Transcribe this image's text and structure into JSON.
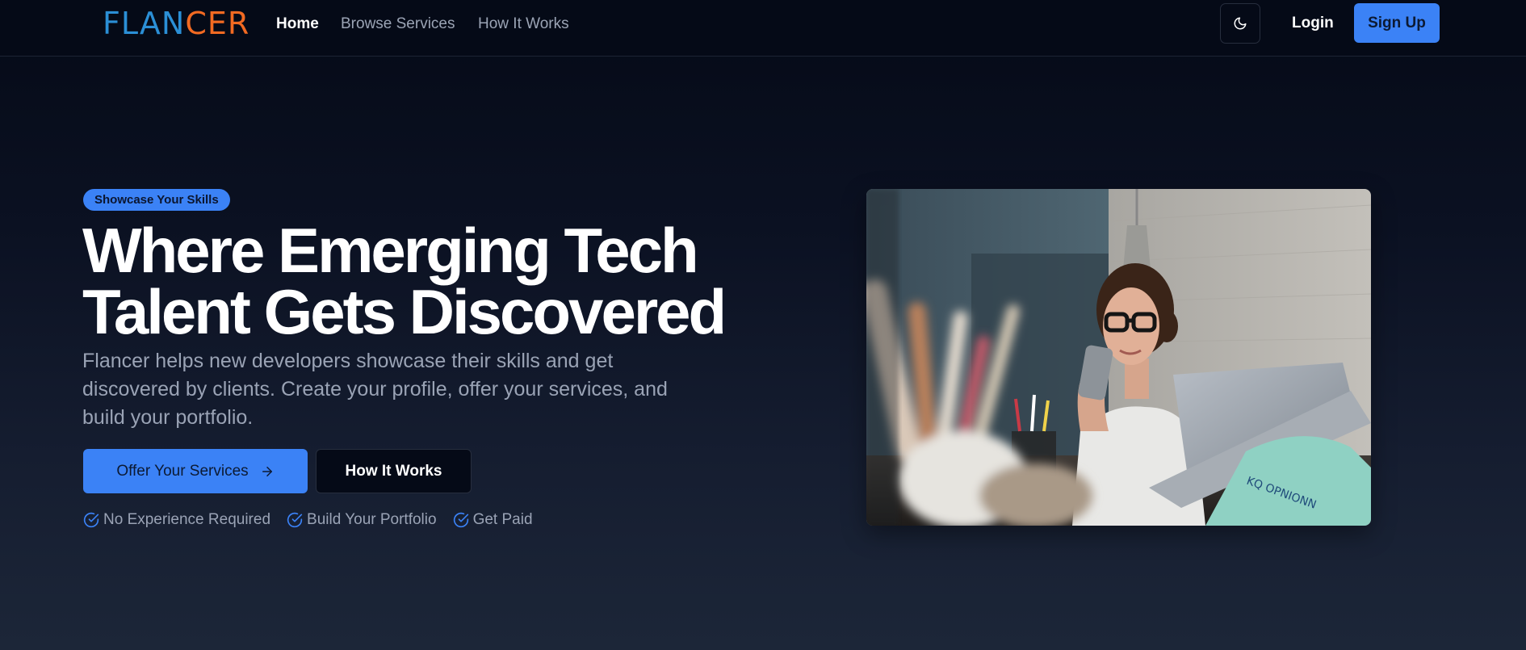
{
  "nav": {
    "logo_part1": "FLAN",
    "logo_part2": "CER",
    "links": [
      "Home",
      "Browse Services",
      "How It Works"
    ],
    "theme_icon": "moon-icon",
    "login_label": "Login",
    "signup_label": "Sign Up"
  },
  "hero": {
    "badge": "Showcase Your Skills",
    "title_line1": "Where Emerging Tech",
    "title_line2": "Talent Gets Discovered",
    "description": "Flancer helps new developers showcase their skills and get discovered by clients. Create your profile, offer your services, and build your portfolio.",
    "primary_button": "Offer Your Services",
    "secondary_button": "How It Works",
    "features": [
      "No Experience Required",
      "Build Your Portfolio",
      "Get Paid"
    ]
  },
  "colors": {
    "accent": "#3b82f6",
    "logo_blue": "#2b8fd6",
    "logo_orange": "#f26a22",
    "background": "#050a17"
  }
}
